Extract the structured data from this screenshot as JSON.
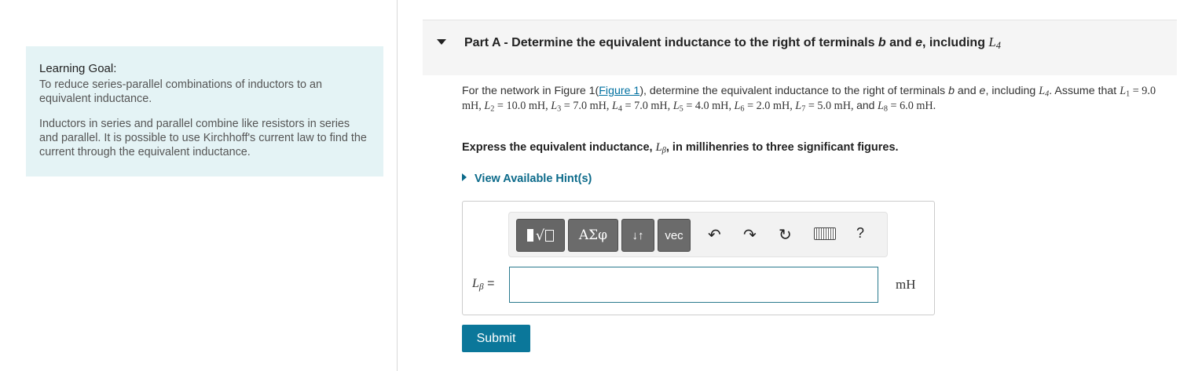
{
  "learning_goal": {
    "title": "Learning Goal:",
    "p1": "To reduce series-parallel combinations of inductors to an equivalent inductance.",
    "p2": "Inductors in series and parallel combine like resistors in series and parallel. It is possible to use Kirchhoff's current law to find the current through the equivalent inductance."
  },
  "part": {
    "prefix": "Part A -",
    "title": "Determine the equivalent inductance to the right of terminals",
    "var_b": "b",
    "and": "and",
    "var_e": "e",
    "including": ", including",
    "L4": "L",
    "L4_sub": "4"
  },
  "problem": {
    "intro": "For the network in Figure 1(",
    "figure_link": "Figure 1",
    "intro_end": "), determine the equivalent inductance to the right of terminals",
    "b": "b",
    "and": "and",
    "e": "e",
    "including": ", including",
    "assume": ". Assume that",
    "values": [
      {
        "sub": "1",
        "value": "9.0 mH"
      },
      {
        "sub": "2",
        "value": "10.0 mH"
      },
      {
        "sub": "3",
        "value": "7.0 mH"
      },
      {
        "sub": "4",
        "value": "7.0 mH"
      },
      {
        "sub": "5",
        "value": "4.0 mH"
      },
      {
        "sub": "6",
        "value": "2.0 mH"
      },
      {
        "sub": "7",
        "value": "5.0 mH"
      },
      {
        "sub": "8",
        "value": "6.0 mH"
      }
    ]
  },
  "instruction": {
    "before": "Express the equivalent inductance,",
    "var": "L",
    "sub": "β",
    "after": ", in millihenries to three significant figures."
  },
  "hints_label": "View Available Hint(s)",
  "toolbar": {
    "greek": "ΑΣφ",
    "arrows": "↓↑",
    "vec": "vec",
    "help": "?"
  },
  "answer": {
    "label_var": "L",
    "label_sub": "β",
    "label_eq": "=",
    "value": "",
    "unit": "mH"
  },
  "submit_label": "Submit"
}
